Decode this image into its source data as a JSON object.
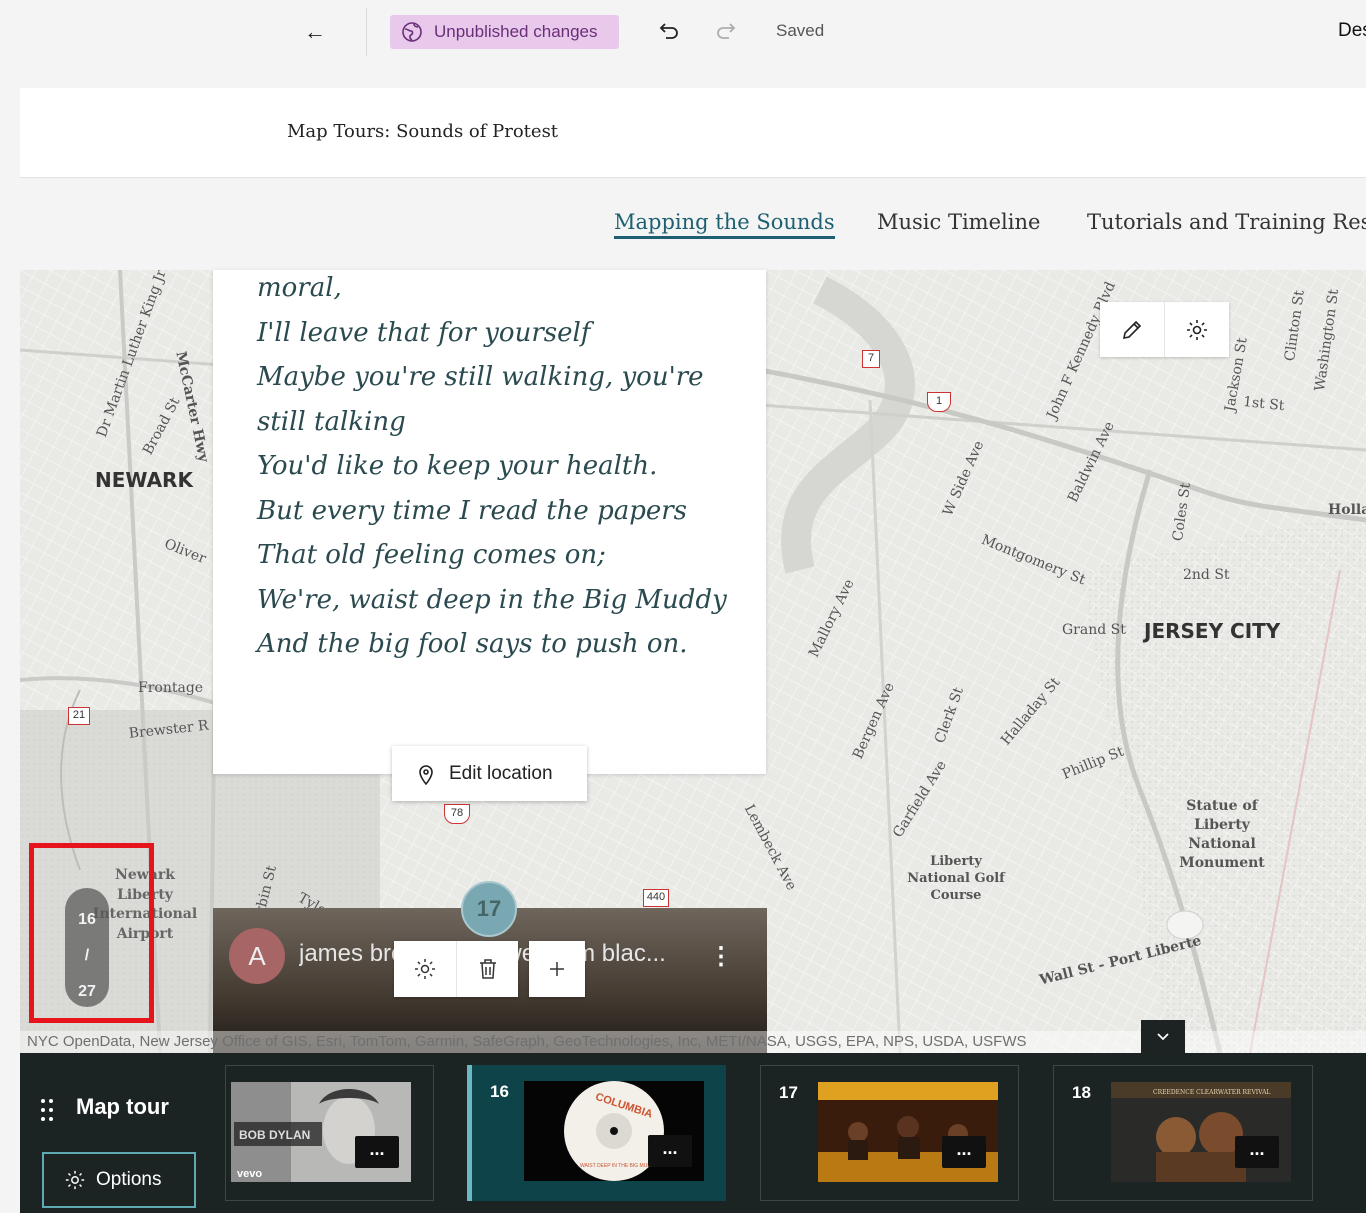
{
  "toolbar": {
    "back_label": "←",
    "unpublished_label": "Unpublished changes",
    "saved_label": "Saved",
    "design_label": "Des"
  },
  "story": {
    "title": "Map Tours: Sounds of Protest"
  },
  "nav": {
    "items": [
      {
        "label": "Mapping the Sounds",
        "active": true
      },
      {
        "label": "Music Timeline",
        "active": false
      },
      {
        "label": "Tutorials and Training Res",
        "active": false
      }
    ]
  },
  "map": {
    "labels": {
      "newark": "NEWARK",
      "jersey_city": "JERSEY CITY",
      "statue": "Statue of Liberty National Monument",
      "golf": "Liberty National Golf Course",
      "airport": "Newark Liberty International Airport",
      "wall_st": "Wall St - Port Liberte",
      "montgomery": "Montgomery St",
      "grand": "Grand St",
      "second": "2nd St",
      "first": "1st St",
      "frontage": "Frontage",
      "brewster": "Brewster R",
      "oliver": "Oliver",
      "broad": "Broad St",
      "mccarter": "McCarter Hwy",
      "mlk": "Dr Martin Luther King Jr",
      "tyler": "Tyler St",
      "corbin": "Corbin St",
      "halladay": "Halladay St",
      "phillip": "Phillip St",
      "clerk": "Clerk St",
      "garfield": "Garfield Ave",
      "bergen": "Bergen Ave",
      "mallory": "Mallory Ave",
      "lembeck": "Lembeck Ave",
      "wside": "W Side Ave",
      "baldwin": "Baldwin Ave",
      "coles": "Coles St",
      "jackson": "Jackson St",
      "clinton": "Clinton St",
      "washington": "Washington St",
      "jfk": "John F Kennedy Blvd",
      "holla": "Holla"
    },
    "shields": [
      "7",
      "1",
      "21",
      "78",
      "440"
    ],
    "attribution": "NYC OpenData, New Jersey Office of GIS, Esri, TomTom, Garmin, SafeGraph, GeoTechnologies, Inc, METI/NASA, USGS, EPA, NPS, USDA, USFWS",
    "edit_location_label": "Edit location",
    "current_pin": "17",
    "counter_current": "16",
    "counter_sep": "/",
    "counter_total": "27"
  },
  "panel": {
    "lyrics": [
      "moral,",
      "I'll leave that for yourself",
      "Maybe you're still walking, you're",
      "still talking",
      "You'd like to keep your health.",
      "But every time I read the papers",
      "That old feeling comes on;",
      "We're, waist deep in the Big Muddy",
      "And the big fool says to push on."
    ]
  },
  "media": {
    "avatar_letter": "A",
    "title": "james brown cold sweat    pm blac...",
    "kebab": "⋮"
  },
  "bottom": {
    "tour_label": "Map tour",
    "options_label": "Options",
    "slides": [
      {
        "num": "",
        "thumb": "bob-dylan",
        "thumb_text": "BOB DYLAN",
        "thumb_sub": "vevo"
      },
      {
        "num": "16",
        "thumb": "columbia-record",
        "thumb_text": "COLUMBIA",
        "thumb_sub": "WAIST DEEP IN THE BIG MUDDY"
      },
      {
        "num": "17",
        "thumb": "concert-stage",
        "thumb_text": "",
        "thumb_sub": ""
      },
      {
        "num": "18",
        "thumb": "ccr-album",
        "thumb_text": "CREEDENCE CLEARWATER REVIVAL",
        "thumb_sub": ""
      }
    ],
    "dots_label": "..."
  },
  "colors": {
    "accent": "#1e6072",
    "unpublished_bg": "#e8c9ec",
    "highlight": "#e8141c",
    "bottom_bg": "#1b2323"
  }
}
